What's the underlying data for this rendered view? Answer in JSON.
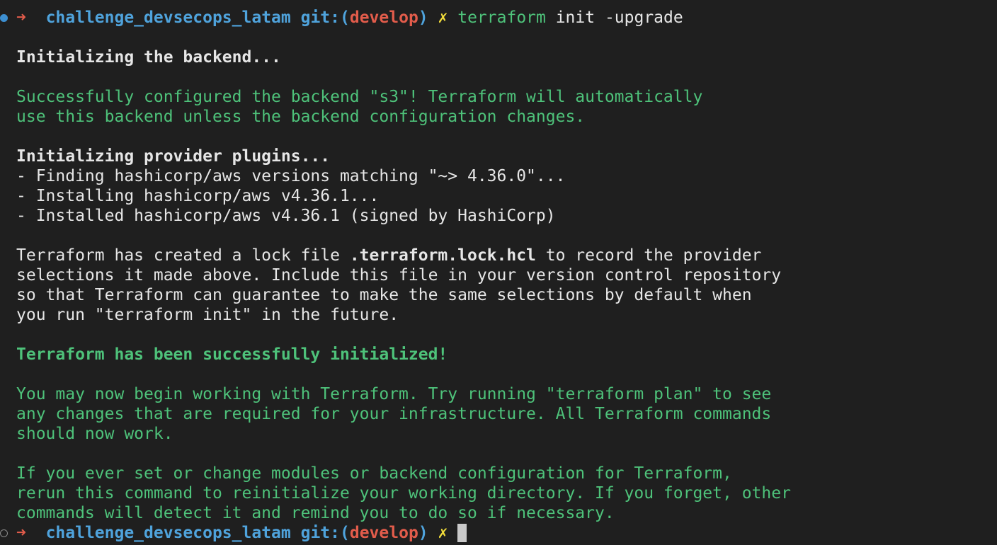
{
  "prompt": {
    "arrow": "➜",
    "directory": "challenge_devsecops_latam",
    "git_prefix": "git:(",
    "branch": "develop",
    "git_suffix": ")",
    "dirty_mark": "✗"
  },
  "command": {
    "program": "terraform",
    "args": " init -upgrade"
  },
  "output": {
    "backend_heading": "Initializing the backend...",
    "backend_success_1": "Successfully configured the backend \"s3\"! Terraform will automatically",
    "backend_success_2": "use this backend unless the backend configuration changes.",
    "plugins_heading": "Initializing provider plugins...",
    "plugin_line_1": "- Finding hashicorp/aws versions matching \"~> 4.36.0\"...",
    "plugin_line_2": "- Installing hashicorp/aws v4.36.1...",
    "plugin_line_3": "- Installed hashicorp/aws v4.36.1 (signed by HashiCorp)",
    "lock_1_pre": "Terraform has created a lock file ",
    "lock_1_file": ".terraform.lock.hcl",
    "lock_1_post": " to record the provider",
    "lock_2": "selections it made above. Include this file in your version control repository",
    "lock_3": "so that Terraform can guarantee to make the same selections by default when",
    "lock_4": "you run \"terraform init\" in the future.",
    "init_success": "Terraform has been successfully initialized!",
    "next_1": "You may now begin working with Terraform. Try running \"terraform plan\" to see",
    "next_2": "any changes that are required for your infrastructure. All Terraform commands",
    "next_3": "should now work.",
    "rerun_1": "If you ever set or change modules or backend configuration for Terraform,",
    "rerun_2": "rerun this command to reinitialize your working directory. If you forget, other",
    "rerun_3": "commands will detect it and remind you to do so if necessary."
  },
  "colors": {
    "background": "#1f1f1f",
    "green": "#4ec27a",
    "blue": "#4fa3dc",
    "red": "#e25c4b",
    "yellow": "#f2dd3b"
  }
}
